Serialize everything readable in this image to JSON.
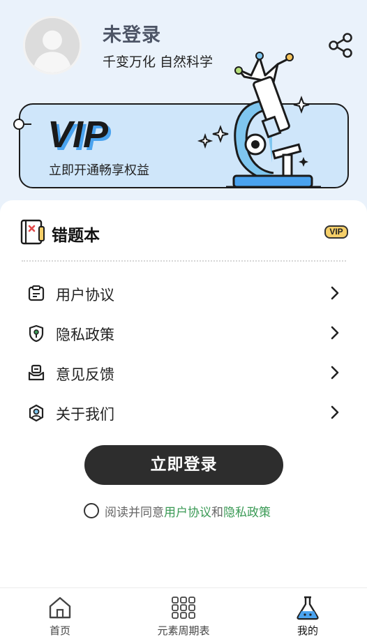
{
  "profile": {
    "name": "未登录",
    "subtitle": "千变万化 自然科学"
  },
  "vip_banner": {
    "logo_text": "VIP",
    "tagline": "立即开通畅享权益"
  },
  "wrong_book": {
    "title": "错题本",
    "badge": "VIP"
  },
  "menu": [
    {
      "label": "用户协议",
      "icon": "clipboard-icon"
    },
    {
      "label": "隐私政策",
      "icon": "shield-icon"
    },
    {
      "label": "意见反馈",
      "icon": "feedback-icon"
    },
    {
      "label": "关于我们",
      "icon": "about-icon"
    }
  ],
  "login_button": "立即登录",
  "agreement": {
    "prefix": "阅读并同意",
    "link1": "用户协议",
    "conj": "和",
    "link2": "隐私政策"
  },
  "tabs": [
    {
      "label": "首页",
      "icon": "home-icon"
    },
    {
      "label": "元素周期表",
      "icon": "periodic-table-icon"
    },
    {
      "label": "我的",
      "icon": "flask-icon",
      "active": true
    }
  ],
  "colors": {
    "accent_green": "#3a9a55",
    "vip_blue": "#cfe6fa",
    "button_dark": "#2d2d2d",
    "badge_gold": "#f5cf69"
  }
}
